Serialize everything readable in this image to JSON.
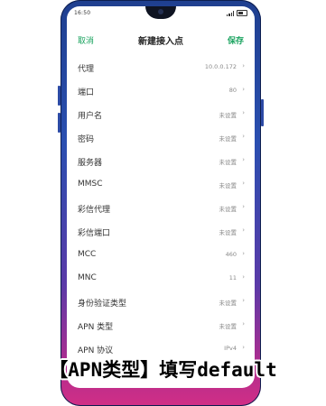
{
  "status": {
    "time": "16:50"
  },
  "header": {
    "cancel_label": "取消",
    "title": "新建接入点",
    "save_label": "保存"
  },
  "rows": [
    {
      "label": "代理",
      "value": "10.0.0.172"
    },
    {
      "label": "端口",
      "value": "80"
    },
    {
      "label": "用户名",
      "value": "未设置"
    },
    {
      "label": "密码",
      "value": "未设置"
    },
    {
      "label": "服务器",
      "value": "未设置"
    },
    {
      "label": "MMSC",
      "value": "未设置"
    },
    {
      "label": "彩信代理",
      "value": "未设置"
    },
    {
      "label": "彩信端口",
      "value": "未设置"
    },
    {
      "label": "MCC",
      "value": "460"
    },
    {
      "label": "MNC",
      "value": "11"
    },
    {
      "label": "身份验证类型",
      "value": "未设置"
    },
    {
      "label": "APN 类型",
      "value": "未设置"
    },
    {
      "label": "APN 协议",
      "value": "IPv4"
    }
  ],
  "caption": "【APN类型】填写default",
  "colors": {
    "accent": "#1aa35f",
    "phone_frame_top": "#1f3f8f",
    "phone_frame_bottom": "#d12f86"
  }
}
